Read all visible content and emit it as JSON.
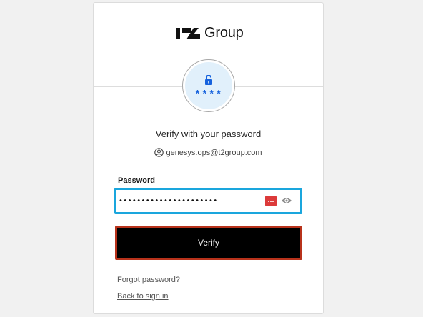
{
  "brand": {
    "logo_text": "Group",
    "logo_icon": "t2-logo-icon"
  },
  "auth": {
    "stars": "****",
    "lock_icon": "unlock-icon",
    "accent_color": "#1662dd",
    "circle_bg": "#e1f0fb"
  },
  "form": {
    "title": "Verify with your password",
    "identifier": "genesys.ops@t2group.com",
    "identifier_icon": "user-circle-icon",
    "password_label": "Password",
    "password_value": "••••••••••••••••••••••",
    "password_manager_icon": "password-manager-icon",
    "reveal_icon": "eye-icon",
    "field_border_color": "#1aa6dd",
    "verify_label": "Verify",
    "verify_bg": "#000000",
    "verify_border_color": "#b8321b"
  },
  "links": {
    "forgot_password": "Forgot password?",
    "back_to_sign_in": "Back to sign in"
  }
}
